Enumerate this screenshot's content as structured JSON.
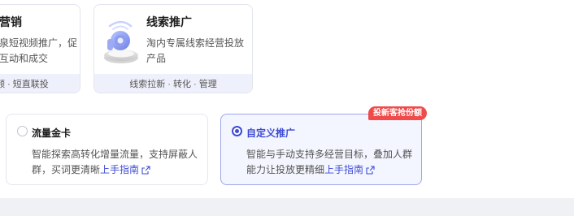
{
  "marketing_cards": [
    {
      "title": "营销",
      "desc_lines": [
        "泉短视频推广，促",
        "互动和成交"
      ],
      "footer": "频 · 短直联投"
    },
    {
      "title": "线索推广",
      "desc": "淘内专属线索经营投放产品",
      "footer": "线索拉新 · 转化 · 管理",
      "icon": "clue-promo-3d-icon"
    }
  ],
  "options": [
    {
      "title": "流量金卡",
      "desc": "智能探索高转化增量流量，支持屏蔽人群，买词更清晰",
      "guide_label": "上手指南",
      "selected": false
    },
    {
      "title": "自定义推广",
      "desc": "智能与手动支持多经营目标，叠加人群能力让投放更精细",
      "guide_label": "上手指南",
      "selected": true,
      "badge": "投新客抢份额"
    }
  ],
  "colors": {
    "accent": "#3e4bd3",
    "badge_bg": "#f04a4a",
    "footer_bg": "#eef0fb",
    "selected_card_bg": "#f4f6ff"
  }
}
